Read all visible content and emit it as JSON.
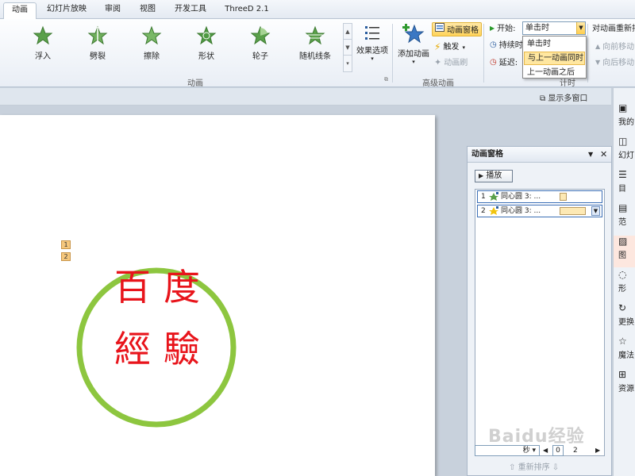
{
  "tabs": [
    {
      "label": "动画",
      "active": true
    },
    {
      "label": "幻灯片放映",
      "active": false
    },
    {
      "label": "审阅",
      "active": false
    },
    {
      "label": "视图",
      "active": false
    },
    {
      "label": "开发工具",
      "active": false
    },
    {
      "label": "ThreeD 2.1",
      "active": false
    }
  ],
  "ribbon": {
    "effects": [
      "浮入",
      "劈裂",
      "擦除",
      "形状",
      "轮子",
      "随机线条"
    ],
    "effect_options": "效果选项",
    "group_animation": "动画",
    "add_animation": "添加动画",
    "animation_pane": "动画窗格",
    "trigger": "触发",
    "animation_painter": "动画刷",
    "group_advanced": "高级动画",
    "start_label": "开始:",
    "start_value": "单击时",
    "duration_label": "持续时",
    "delay_label": "延迟:",
    "timing_group_partial": "计时",
    "reorder_title": "对动画重新排",
    "move_earlier": "向前移动",
    "move_later": "向后移动",
    "start_options": [
      "单击时",
      "与上一动画同时",
      "上一动画之后"
    ],
    "selected_option_index": 1
  },
  "docbar": {
    "show_multi": "显示多窗口"
  },
  "slide": {
    "tags": [
      "1",
      "2"
    ],
    "seal_chars": [
      "百",
      "度",
      "經",
      "驗"
    ],
    "seal_ring_color": "#8dc63f",
    "seal_text_color": "#e8141b"
  },
  "pane": {
    "title": "动画窗格",
    "play": "播放",
    "items": [
      {
        "num": "1",
        "name": "同心圆 3: ..."
      },
      {
        "num": "2",
        "name": "同心圆 3: ..."
      }
    ],
    "seconds": "秒",
    "page_0": "0",
    "page_2": "2",
    "reorder": "重新排序"
  },
  "sidepanel": {
    "items": [
      "我的",
      "幻灯",
      "目",
      "范",
      "图",
      "形",
      "更换",
      "魔法",
      "资源"
    ]
  },
  "watermark": "Baidu经验"
}
